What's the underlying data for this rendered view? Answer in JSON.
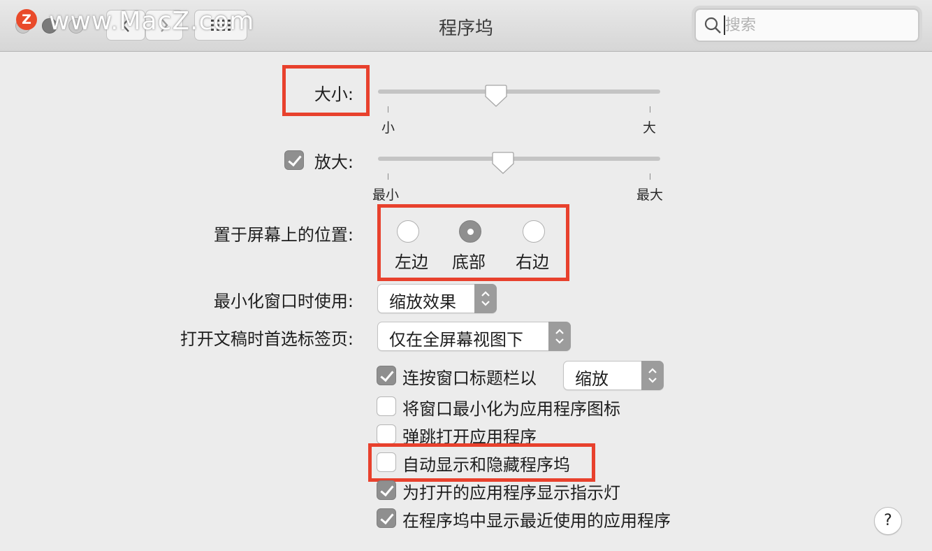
{
  "window": {
    "title": "程序坞"
  },
  "watermark": {
    "logo_letter": "Z",
    "text": "www.MacZ.com"
  },
  "toolbar": {
    "back_icon": "chevron-left-icon",
    "forward_icon": "chevron-right-icon",
    "grid_icon": "grid-icon"
  },
  "search": {
    "placeholder": "搜索",
    "icon": "search-icon"
  },
  "size": {
    "label": "大小:",
    "min_label": "小",
    "max_label": "大",
    "value": 0.42
  },
  "magnification": {
    "label": "放大:",
    "checked": true,
    "min_label": "最小",
    "max_label": "最大",
    "value": 0.44
  },
  "position": {
    "label": "置于屏幕上的位置:",
    "options": [
      {
        "label": "左边",
        "selected": false
      },
      {
        "label": "底部",
        "selected": true
      },
      {
        "label": "右边",
        "selected": false
      }
    ]
  },
  "minimize_using": {
    "label": "最小化窗口时使用:",
    "value": "缩放效果"
  },
  "prefer_tabs": {
    "label": "打开文稿时首选标签页:",
    "value": "仅在全屏幕视图下"
  },
  "checkboxes": [
    {
      "label": "连按窗口标题栏以",
      "checked": true
    },
    {
      "label": "将窗口最小化为应用程序图标",
      "checked": false
    },
    {
      "label": "弹跳打开应用程序",
      "checked": false
    },
    {
      "label": "自动显示和隐藏程序坞",
      "checked": false
    },
    {
      "label": "为打开的应用程序显示指示灯",
      "checked": true
    },
    {
      "label": "在程序坞中显示最近使用的应用程序",
      "checked": true
    }
  ],
  "double_click_action": {
    "value": "缩放"
  },
  "help": {
    "label": "?"
  },
  "colors": {
    "highlight": "#e8412d",
    "control_gray": "#8f8f8f"
  }
}
